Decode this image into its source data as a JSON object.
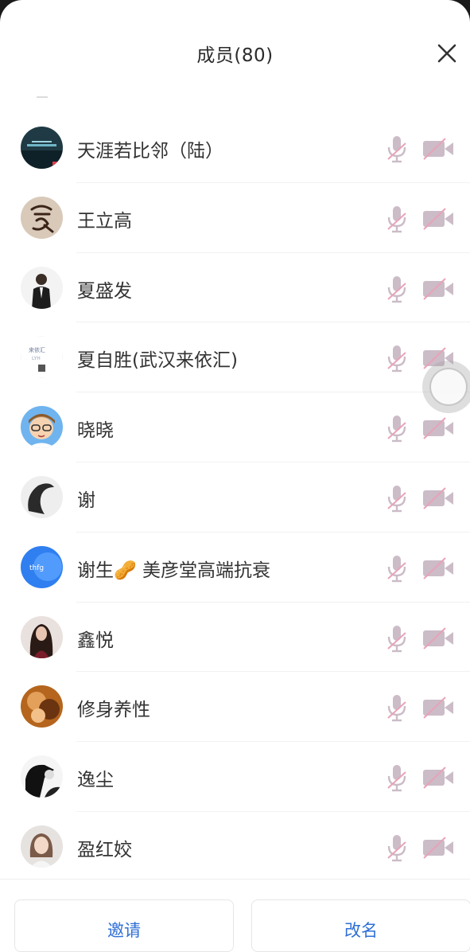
{
  "header": {
    "title": "成员(80)"
  },
  "members": [
    {
      "name": "天涯若比邻（陆）",
      "avatar": "avatar-landscape"
    },
    {
      "name": "王立高",
      "avatar": "avatar-calligraphy"
    },
    {
      "name": "夏盛发",
      "avatar": "avatar-man-suit"
    },
    {
      "name": "夏自胜(武汉来依汇)",
      "avatar": "avatar-logo-text"
    },
    {
      "name": "晓晓",
      "avatar": "avatar-cartoon-boy"
    },
    {
      "name": "谢",
      "avatar": "avatar-silhouette"
    },
    {
      "name": "谢生🥜 美彦堂高端抗衰",
      "avatar": "avatar-blue-circle"
    },
    {
      "name": "鑫悦",
      "avatar": "avatar-woman-dark"
    },
    {
      "name": "修身养性",
      "avatar": "avatar-warm-brown"
    },
    {
      "name": "逸尘",
      "avatar": "avatar-bw-portrait"
    },
    {
      "name": "盈红姣",
      "avatar": "avatar-woman-light"
    }
  ],
  "footer": {
    "invite_label": "邀请",
    "rename_label": "改名"
  },
  "colors": {
    "accent": "#2f6fd6",
    "muted_icon": "#c9b9c4",
    "slash": "#e8a3b8"
  }
}
